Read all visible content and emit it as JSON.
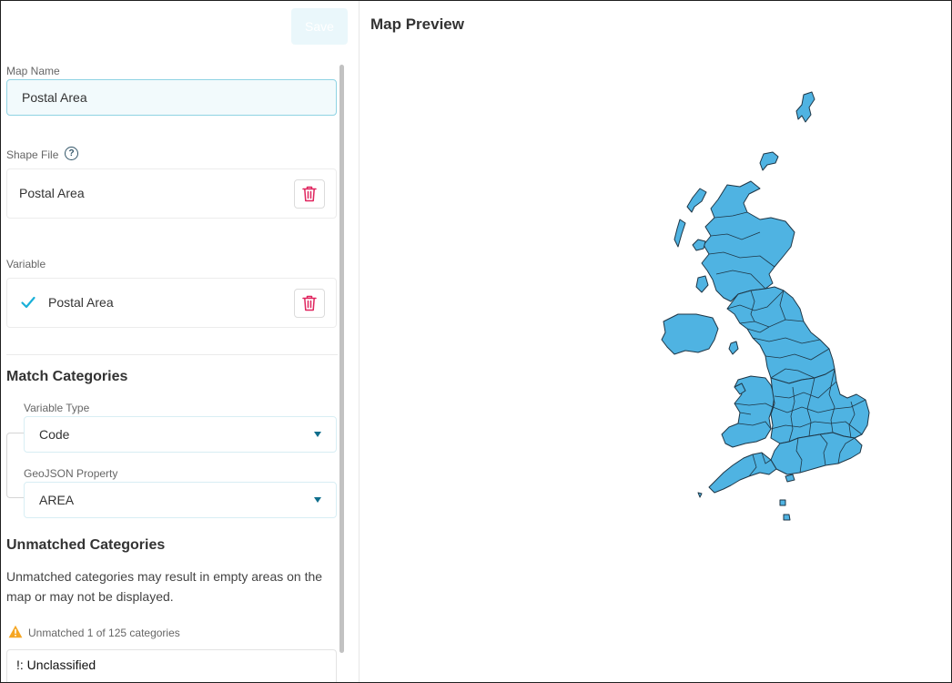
{
  "toolbar": {
    "save_label": "Save"
  },
  "map_name": {
    "label": "Map Name",
    "value": "Postal Area"
  },
  "shape_file": {
    "label": "Shape File",
    "help_icon": "question-circle-icon",
    "value": "Postal Area",
    "delete_icon": "trash-icon"
  },
  "variable": {
    "label": "Variable",
    "value": "Postal Area",
    "check_icon": "check-icon",
    "delete_icon": "trash-icon"
  },
  "match_categories": {
    "title": "Match Categories",
    "variable_type": {
      "label": "Variable Type",
      "value": "Code"
    },
    "geojson_property": {
      "label": "GeoJSON Property",
      "value": "AREA"
    }
  },
  "unmatched": {
    "title": "Unmatched Categories",
    "description": "Unmatched categories may result in empty areas on the map or may not be displayed.",
    "warning_icon": "warning-triangle-icon",
    "warning_text": "Unmatched 1 of 125 categories",
    "items": [
      "!: Unclassified"
    ]
  },
  "preview": {
    "title": "Map Preview",
    "fill_color": "#4fb3e2",
    "stroke_color": "#1e3646"
  },
  "colors": {
    "accent": "#0e6e8c",
    "danger": "#e0245e",
    "input_bg": "#f2fafc",
    "warning": "#f5a623"
  }
}
